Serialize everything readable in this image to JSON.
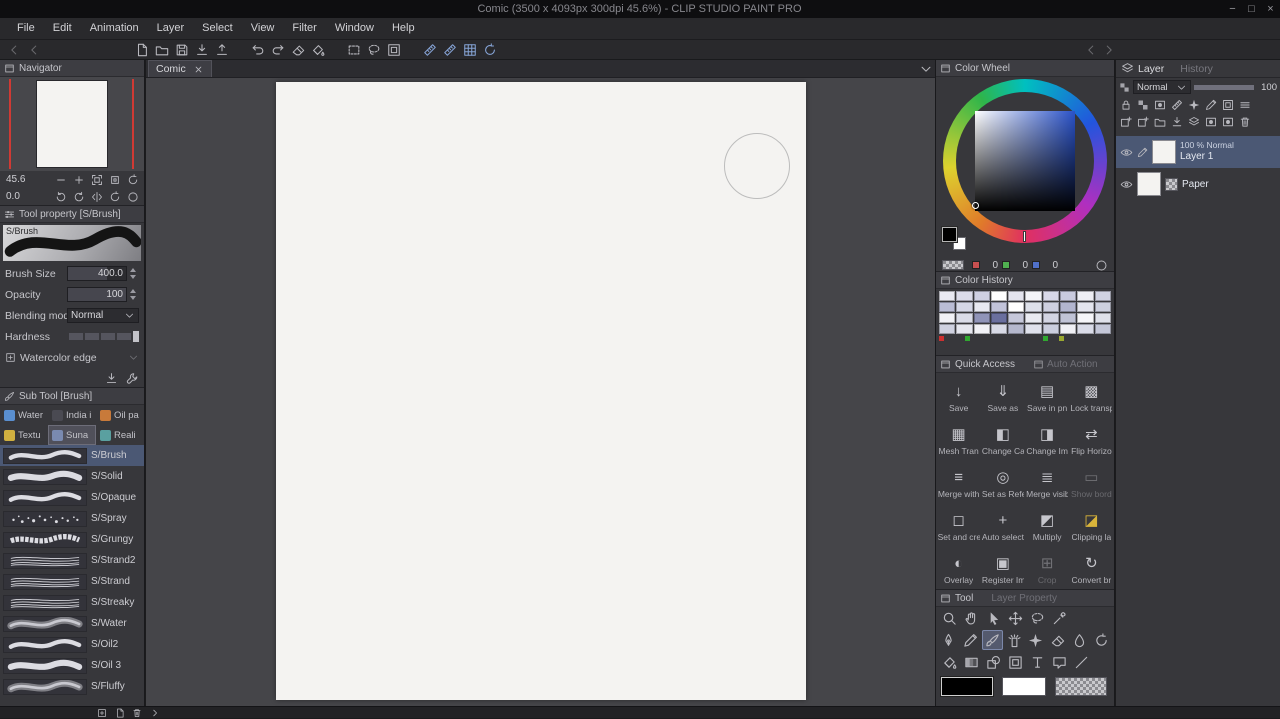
{
  "window": {
    "title": "Comic (3500 x 4093px 300dpi 45.6%) - CLIP STUDIO PAINT PRO",
    "controls": {
      "minimize": "−",
      "maximize": "□",
      "close": "×"
    }
  },
  "menu": {
    "items": [
      "File",
      "Edit",
      "Animation",
      "Layer",
      "Select",
      "View",
      "Filter",
      "Window",
      "Help"
    ]
  },
  "navigator": {
    "title": "Navigator",
    "zoom_value": "45.6",
    "rotation_value": "0.0"
  },
  "tool_property": {
    "title": "Tool property [S/Brush]",
    "preview_label": "S/Brush",
    "rows": [
      {
        "label": "Brush Size",
        "value": "400.0"
      },
      {
        "label": "Opacity",
        "value": "100"
      },
      {
        "label": "Blending mode",
        "value": "Normal"
      },
      {
        "label": "Hardness",
        "value": ""
      },
      {
        "label": "Watercolor edge",
        "value": ""
      }
    ]
  },
  "sub_tool": {
    "title": "Sub Tool [Brush]",
    "tabs": [
      {
        "label": "Water"
      },
      {
        "label": "India i"
      },
      {
        "label": "Oil pa"
      },
      {
        "label": "Textu"
      },
      {
        "label": "Suna",
        "selected": true
      },
      {
        "label": "Reali"
      }
    ],
    "brushes": [
      {
        "name": "S/Brush",
        "selected": true
      },
      {
        "name": "S/Solid"
      },
      {
        "name": "S/Opaque"
      },
      {
        "name": "S/Spray"
      },
      {
        "name": "S/Grungy"
      },
      {
        "name": "S/Strand2"
      },
      {
        "name": "S/Strand"
      },
      {
        "name": "S/Streaky"
      },
      {
        "name": "S/Water"
      },
      {
        "name": "S/Oil2"
      },
      {
        "name": "S/Oil 3"
      },
      {
        "name": "S/Fluffy"
      }
    ]
  },
  "document": {
    "tab_label": "Comic",
    "page_color": "#f4f3f1"
  },
  "color_wheel": {
    "title": "Color Wheel",
    "main_color": "#000000",
    "sub_color": "#ffffff",
    "values": [
      {
        "value": "0",
        "chip": "#c85050"
      },
      {
        "value": "0",
        "chip": "#50b050"
      },
      {
        "value": "0",
        "chip": "#5070c8"
      }
    ]
  },
  "color_history": {
    "title": "Color History",
    "swatches": [
      "#e9e9f2",
      "#dcdcea",
      "#cfd0e3",
      "#ffffff",
      "#e4e4ee",
      "#f4f4f8",
      "#d8d8e8",
      "#c9cade",
      "#eeeef4",
      "#d0d2e2",
      "#babdd5",
      "#d5d7e6",
      "#e8e9f1",
      "#c2c4da",
      "#ffffff",
      "#dde0ea",
      "#ced0e0",
      "#b2b5cf",
      "#e4e5ee",
      "#cdd0df",
      "#f1f1f6",
      "#dadce8",
      "#9094b8",
      "#6a6f9e",
      "#c6c8da",
      "#e9eaf1",
      "#d3d5e3",
      "#c0c3d6",
      "#f6f6f9",
      "#dfe1ea",
      "#cfd1e0",
      "#e6e7ef",
      "#f2f2f6",
      "#d8dae6",
      "#b5b8cd",
      "#e0e2ec",
      "#cbcede",
      "#f0f0f5",
      "#dadce8",
      "#c4c7d8"
    ],
    "markers": [
      "#cc3030",
      "#30a830",
      "#30a830",
      "#9aa830"
    ]
  },
  "quick_access": {
    "title": "Quick Access",
    "inactive_tab": "Auto Action",
    "items": [
      {
        "label": "Save",
        "glyph": "↓"
      },
      {
        "label": "Save as",
        "glyph": "⇓"
      },
      {
        "label": "Save in pn",
        "glyph": "▤"
      },
      {
        "label": "Lock transp",
        "glyph": "▩"
      },
      {
        "label": "Mesh Tran",
        "glyph": "▦"
      },
      {
        "label": "Change Ca",
        "glyph": "◧"
      },
      {
        "label": "Change Im",
        "glyph": "◨"
      },
      {
        "label": "Flip Horizo",
        "glyph": "⇄"
      },
      {
        "label": "Merge with",
        "glyph": "≡"
      },
      {
        "label": "Set as Refe",
        "glyph": "◎"
      },
      {
        "label": "Merge visib",
        "glyph": "≣"
      },
      {
        "label": "Show bord",
        "glyph": "▭",
        "disabled": true
      },
      {
        "label": "Set and cre",
        "glyph": "◻"
      },
      {
        "label": "Auto select",
        "glyph": "+"
      },
      {
        "label": "Multiply",
        "glyph": "◩"
      },
      {
        "label": "Clipping la",
        "glyph": "◪",
        "color": "#d9b43a"
      },
      {
        "label": "Overlay",
        "glyph": "◐"
      },
      {
        "label": "Register Im",
        "glyph": "▣"
      },
      {
        "label": "Crop",
        "glyph": "⊞",
        "disabled": true
      },
      {
        "label": "Convert br",
        "glyph": "↻"
      }
    ]
  },
  "layers": {
    "tab_active": "Layer",
    "tab_inactive": "History",
    "blend_mode": "Normal",
    "opacity_value": "100",
    "items": [
      {
        "info": "100 % Normal",
        "name": "Layer 1",
        "selected": true
      },
      {
        "info": "",
        "name": "Paper"
      }
    ]
  },
  "tool_panel": {
    "title": "Tool",
    "inactive_tab": "Layer Property"
  }
}
